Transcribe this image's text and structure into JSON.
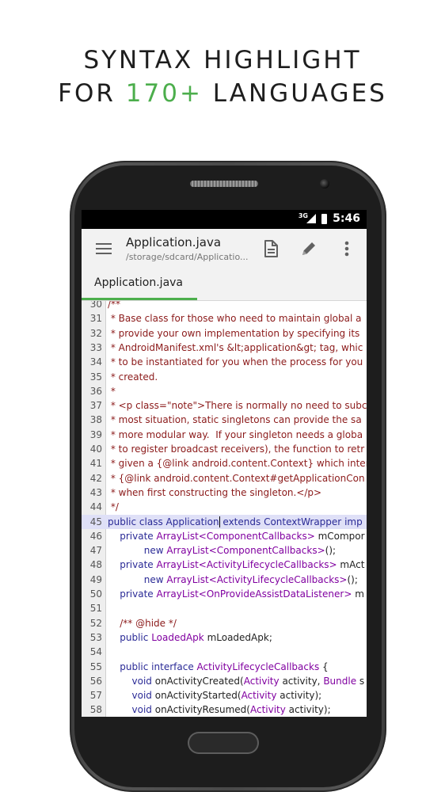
{
  "headline": {
    "line1": "SYNTAX HIGHLIGHT",
    "line2_prefix": "FOR ",
    "line2_accent": "170+",
    "line2_suffix": " LANGUAGES"
  },
  "colors": {
    "accent": "#4cae4c",
    "comment": "#8b1a1a",
    "keyword": "#2a2a96",
    "type": "#8000a0",
    "highlight_line": "#dfe0f7"
  },
  "status_bar": {
    "network": "3G",
    "time": "5:46"
  },
  "toolbar": {
    "menu_icon": "hamburger-menu-icon",
    "title": "Application.java",
    "subtitle": "/storage/sdcard/Applicatio...",
    "actions": [
      "file-icon",
      "pencil-icon",
      "more-vert-icon"
    ]
  },
  "tabs": [
    {
      "label": "Application.java",
      "active": true
    }
  ],
  "editor": {
    "highlighted_line": 45,
    "lines": [
      {
        "n": "30",
        "parts": [
          {
            "t": "/**",
            "c": "cmt"
          }
        ]
      },
      {
        "n": "31",
        "parts": [
          {
            "t": " * Base class for those who need to maintain global a",
            "c": "cmt"
          }
        ]
      },
      {
        "n": "32",
        "parts": [
          {
            "t": " * provide your own implementation by specifying its",
            "c": "cmt"
          }
        ]
      },
      {
        "n": "33",
        "parts": [
          {
            "t": " * AndroidManifest.xml's &lt;application&gt; tag, whic",
            "c": "cmt"
          }
        ]
      },
      {
        "n": "34",
        "parts": [
          {
            "t": " * to be instantiated for you when the process for you",
            "c": "cmt"
          }
        ]
      },
      {
        "n": "35",
        "parts": [
          {
            "t": " * created.",
            "c": "cmt"
          }
        ]
      },
      {
        "n": "36",
        "parts": [
          {
            "t": " *",
            "c": "cmt"
          }
        ]
      },
      {
        "n": "37",
        "parts": [
          {
            "t": " * <p class=\"note\">There is normally no need to subc",
            "c": "cmt"
          }
        ]
      },
      {
        "n": "38",
        "parts": [
          {
            "t": " * most situation, static singletons can provide the sa",
            "c": "cmt"
          }
        ]
      },
      {
        "n": "39",
        "parts": [
          {
            "t": " * more modular way.  If your singleton needs a globa",
            "c": "cmt"
          }
        ]
      },
      {
        "n": "40",
        "parts": [
          {
            "t": " * to register broadcast receivers), the function to retr",
            "c": "cmt"
          }
        ]
      },
      {
        "n": "41",
        "parts": [
          {
            "t": " * given a {@link android.content.Context} which inter",
            "c": "cmt"
          }
        ]
      },
      {
        "n": "42",
        "parts": [
          {
            "t": " * {@link android.content.Context#getApplicationCon",
            "c": "cmt"
          }
        ]
      },
      {
        "n": "43",
        "parts": [
          {
            "t": " * when first constructing the singleton.</p>",
            "c": "cmt"
          }
        ]
      },
      {
        "n": "44",
        "parts": [
          {
            "t": " */",
            "c": "cmt"
          }
        ]
      },
      {
        "n": "45",
        "parts": [
          {
            "t": "public class ",
            "c": "kw"
          },
          {
            "t": "Application",
            "c": "kw"
          },
          {
            "t": "|",
            "c": "cursor"
          },
          {
            "t": " extends ",
            "c": "kw"
          },
          {
            "t": "ContextWrapper",
            "c": "kw"
          },
          {
            "t": " imp",
            "c": "kw"
          }
        ]
      },
      {
        "n": "46",
        "parts": [
          {
            "t": "    private ",
            "c": "kw"
          },
          {
            "t": "ArrayList<ComponentCallbacks>",
            "c": "type"
          },
          {
            "t": " mCompor",
            "c": "plain"
          }
        ]
      },
      {
        "n": "47",
        "parts": [
          {
            "t": "            new ",
            "c": "kw"
          },
          {
            "t": "ArrayList<ComponentCallbacks>",
            "c": "type"
          },
          {
            "t": "();",
            "c": "plain"
          }
        ]
      },
      {
        "n": "48",
        "parts": [
          {
            "t": "    private ",
            "c": "kw"
          },
          {
            "t": "ArrayList<ActivityLifecycleCallbacks>",
            "c": "type"
          },
          {
            "t": " mAct",
            "c": "plain"
          }
        ]
      },
      {
        "n": "49",
        "parts": [
          {
            "t": "            new ",
            "c": "kw"
          },
          {
            "t": "ArrayList<ActivityLifecycleCallbacks>",
            "c": "type"
          },
          {
            "t": "();",
            "c": "plain"
          }
        ]
      },
      {
        "n": "50",
        "parts": [
          {
            "t": "    private ",
            "c": "kw"
          },
          {
            "t": "ArrayList<OnProvideAssistDataListener>",
            "c": "type"
          },
          {
            "t": " m",
            "c": "plain"
          }
        ]
      },
      {
        "n": "51",
        "parts": []
      },
      {
        "n": "52",
        "parts": [
          {
            "t": "    /** @hide */",
            "c": "cmt"
          }
        ]
      },
      {
        "n": "53",
        "parts": [
          {
            "t": "    public ",
            "c": "kw"
          },
          {
            "t": "LoadedApk",
            "c": "type"
          },
          {
            "t": " mLoadedApk;",
            "c": "plain"
          }
        ]
      },
      {
        "n": "54",
        "parts": []
      },
      {
        "n": "55",
        "parts": [
          {
            "t": "    public interface ",
            "c": "kw"
          },
          {
            "t": "ActivityLifecycleCallbacks",
            "c": "type"
          },
          {
            "t": " {",
            "c": "plain"
          }
        ]
      },
      {
        "n": "56",
        "parts": [
          {
            "t": "        void ",
            "c": "kw"
          },
          {
            "t": "onActivityCreated(",
            "c": "plain"
          },
          {
            "t": "Activity",
            "c": "type"
          },
          {
            "t": " activity, ",
            "c": "plain"
          },
          {
            "t": "Bundle",
            "c": "type"
          },
          {
            "t": " s",
            "c": "plain"
          }
        ]
      },
      {
        "n": "57",
        "parts": [
          {
            "t": "        void ",
            "c": "kw"
          },
          {
            "t": "onActivityStarted(",
            "c": "plain"
          },
          {
            "t": "Activity",
            "c": "type"
          },
          {
            "t": " activity);",
            "c": "plain"
          }
        ]
      },
      {
        "n": "58",
        "parts": [
          {
            "t": "        void ",
            "c": "kw"
          },
          {
            "t": "onActivityResumed(",
            "c": "plain"
          },
          {
            "t": "Activity",
            "c": "type"
          },
          {
            "t": " activity);",
            "c": "plain"
          }
        ]
      }
    ]
  }
}
